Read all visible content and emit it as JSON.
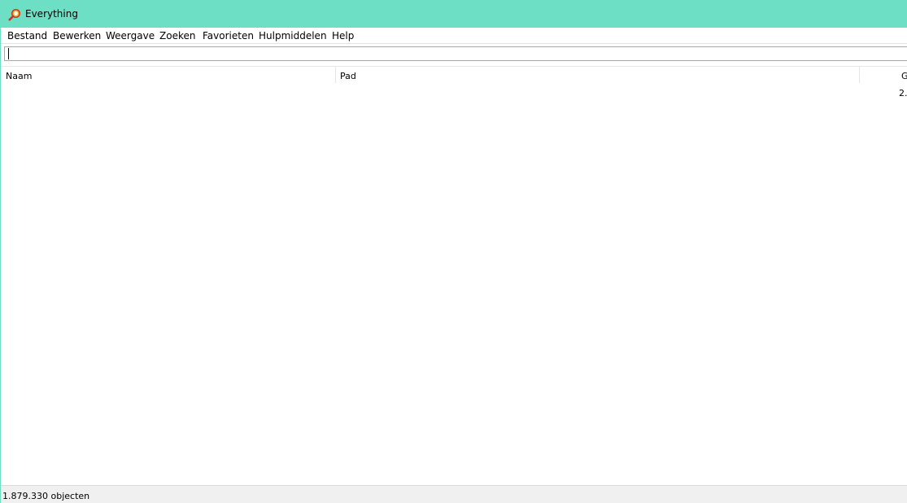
{
  "window": {
    "title": "Everything",
    "accent_color": "#6ddfc5",
    "icon": "magnifier-icon"
  },
  "menu": {
    "items": [
      "Bestand",
      "Bewerken",
      "Weergave",
      "Zoeken",
      "Favorieten",
      "Hulpmiddelen",
      "Help"
    ]
  },
  "search": {
    "value": "",
    "placeholder": ""
  },
  "columns": {
    "name": "Naam",
    "path": "Pad",
    "size": "G"
  },
  "results": {
    "rows": [
      {
        "name": "",
        "path": "",
        "size": "2."
      }
    ]
  },
  "status": {
    "text": "1.879.330 objecten"
  }
}
